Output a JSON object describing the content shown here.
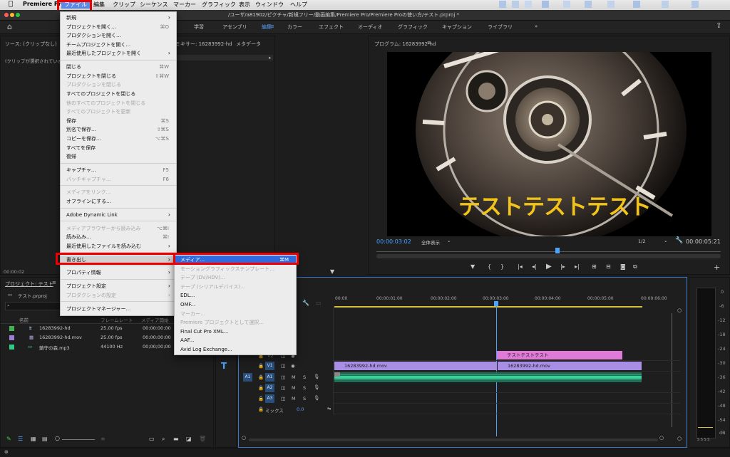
{
  "menubar": {
    "app_name": "Premiere Pro",
    "items": [
      "ファイル",
      "編集",
      "クリップ",
      "シーケンス",
      "マーカー",
      "グラフィック",
      "表示",
      "ウィンドウ",
      "ヘルプ"
    ]
  },
  "window": {
    "title": "/ユーザ/a81902/ピクチャ/新規フリー/動画編集/Premiere Pro/Premiere Proの使い方/テスト.prproj *"
  },
  "workspaces": [
    "学習",
    "アセンブリ",
    "編集",
    "カラー",
    "エフェクト",
    "オーディオ",
    "グラフィック",
    "キャプション",
    "ライブラリ"
  ],
  "active_workspace": "編集",
  "more_glyph": "»",
  "source_panel": {
    "tab": "ソース: (クリップなし)",
    "empty_msg": "(クリップが選択されていま",
    "mixer_tab": "ミキサー: 16283992-hd",
    "metadata_tab": "メタデータ",
    "timecode": "00:00:02"
  },
  "program": {
    "tab": "プログラム: 16283992-hd",
    "overlay_text": "テストテストテスト",
    "timecode": "00:00:03:02",
    "fit": "全体表示",
    "resolution": "1/2",
    "duration": "00:00:05:21"
  },
  "project": {
    "tab": "プロジェクト: テスト",
    "file": "テスト.prproj",
    "search_glyph": "⌕",
    "col_name": "名前",
    "col_fps": "フレームレート",
    "col_start": "メディア開始",
    "items": [
      {
        "name": "16283992-hd",
        "fps": "25.00 fps",
        "start": "00:00:00:00",
        "color": "#3fb34f"
      },
      {
        "name": "16283992-hd.mov",
        "fps": "25.00 fps",
        "start": "00:00:00:00",
        "color": "#9b7fd4"
      },
      {
        "name": "鎮守の森.mp3",
        "fps": "44100 Hz",
        "start": "00;00;00;00",
        "color": "#2fc98a"
      }
    ]
  },
  "file_menu": [
    {
      "label": "新規",
      "arrow": true
    },
    {
      "label": "プロジェクトを開く...",
      "sc": "⌘O"
    },
    {
      "label": "プロダクションを開く..."
    },
    {
      "label": "チームプロジェクトを開く..."
    },
    {
      "label": "最近使用したプロジェクトを開く",
      "arrow": true
    },
    {
      "sep": true
    },
    {
      "label": "閉じる",
      "sc": "⌘W"
    },
    {
      "label": "プロジェクトを閉じる",
      "sc": "⇧⌘W"
    },
    {
      "label": "プロダクションを閉じる",
      "dis": true
    },
    {
      "label": "すべてのプロジェクトを閉じる"
    },
    {
      "label": "他のすべてのプロジェクトを閉じる",
      "dis": true
    },
    {
      "label": "すべてのプロジェクトを更新",
      "dis": true
    },
    {
      "label": "保存",
      "sc": "⌘S"
    },
    {
      "label": "別名で保存...",
      "sc": "⇧⌘S"
    },
    {
      "label": "コピーを保存...",
      "sc": "⌥⌘S"
    },
    {
      "label": "すべてを保存"
    },
    {
      "label": "復帰"
    },
    {
      "sep": true
    },
    {
      "label": "キャプチャ...",
      "sc": "F5"
    },
    {
      "label": "バッチキャプチャ...",
      "sc": "F6",
      "dis": true
    },
    {
      "sep": true
    },
    {
      "label": "メディアをリンク...",
      "dis": true
    },
    {
      "label": "オフラインにする..."
    },
    {
      "sep": true
    },
    {
      "label": "Adobe Dynamic Link",
      "arrow": true
    },
    {
      "sep": true
    },
    {
      "label": "メディアブラウザーから読み込み",
      "sc": "⌥⌘I",
      "dis": true
    },
    {
      "label": "読み込み...",
      "sc": "⌘I"
    },
    {
      "label": "最近使用したファイルを読み込む",
      "arrow": true
    },
    {
      "sep": true
    },
    {
      "label": "書き出し",
      "arrow": true,
      "sel": true
    },
    {
      "sep": true
    },
    {
      "label": "プロパティ情報",
      "arrow": true
    },
    {
      "sep": true
    },
    {
      "label": "プロジェクト設定",
      "arrow": true
    },
    {
      "label": "プロダクションの設定",
      "arrow": true,
      "dis": true
    },
    {
      "sep": true
    },
    {
      "label": "プロジェクトマネージャー..."
    }
  ],
  "export_menu": [
    {
      "label": "メディア...",
      "sc": "⌘M",
      "hl": true
    },
    {
      "label": "モーショングラフィックステンプレート...",
      "dis": true
    },
    {
      "label": "テープ (DV/HDV)...",
      "dis": true
    },
    {
      "label": "テープ (シリアルデバイス)...",
      "dis": true
    },
    {
      "label": "EDL..."
    },
    {
      "label": "OMF..."
    },
    {
      "label": "マーカー...",
      "dis": true
    },
    {
      "label": "Premiere プロジェクトとして選択...",
      "dis": true
    },
    {
      "label": "Final Cut Pro XML..."
    },
    {
      "label": "AAF..."
    },
    {
      "label": "Avid Log Exchange..."
    }
  ],
  "timeline": {
    "ruler": [
      "00:00",
      "00:00:01:00",
      "00:00:02:00",
      "00:00:03:00",
      "00:00:04:00",
      "00:00:05:00",
      "00:00:06:00"
    ],
    "tracks_video": [
      "V3",
      "V2",
      "V1"
    ],
    "tracks_audio": [
      "A1",
      "A2",
      "A3"
    ],
    "mix_label": "ミックス",
    "mix_value": "0.0",
    "title_clip": "テストテストテスト",
    "v1_clip_a": "16283992-hd.mov",
    "v1_clip_b": "16283992-hd.mov",
    "src_patch_a1": "A1",
    "ms_m": "M",
    "ms_s": "S"
  },
  "meter_scale": [
    "0",
    "-6",
    "-12",
    "-18",
    "-24",
    "-30",
    "-36",
    "-42",
    "-48",
    "-54",
    "dB"
  ],
  "meter_bottom": "S S S S",
  "colors": {
    "accent": "#2f6ae0",
    "title_clip": "#e07ad8",
    "video_clip": "#a98ee6",
    "audio_clip": "#2fa57e",
    "timecode": "#4aa3ff",
    "overlay_text": "#f2c318"
  }
}
